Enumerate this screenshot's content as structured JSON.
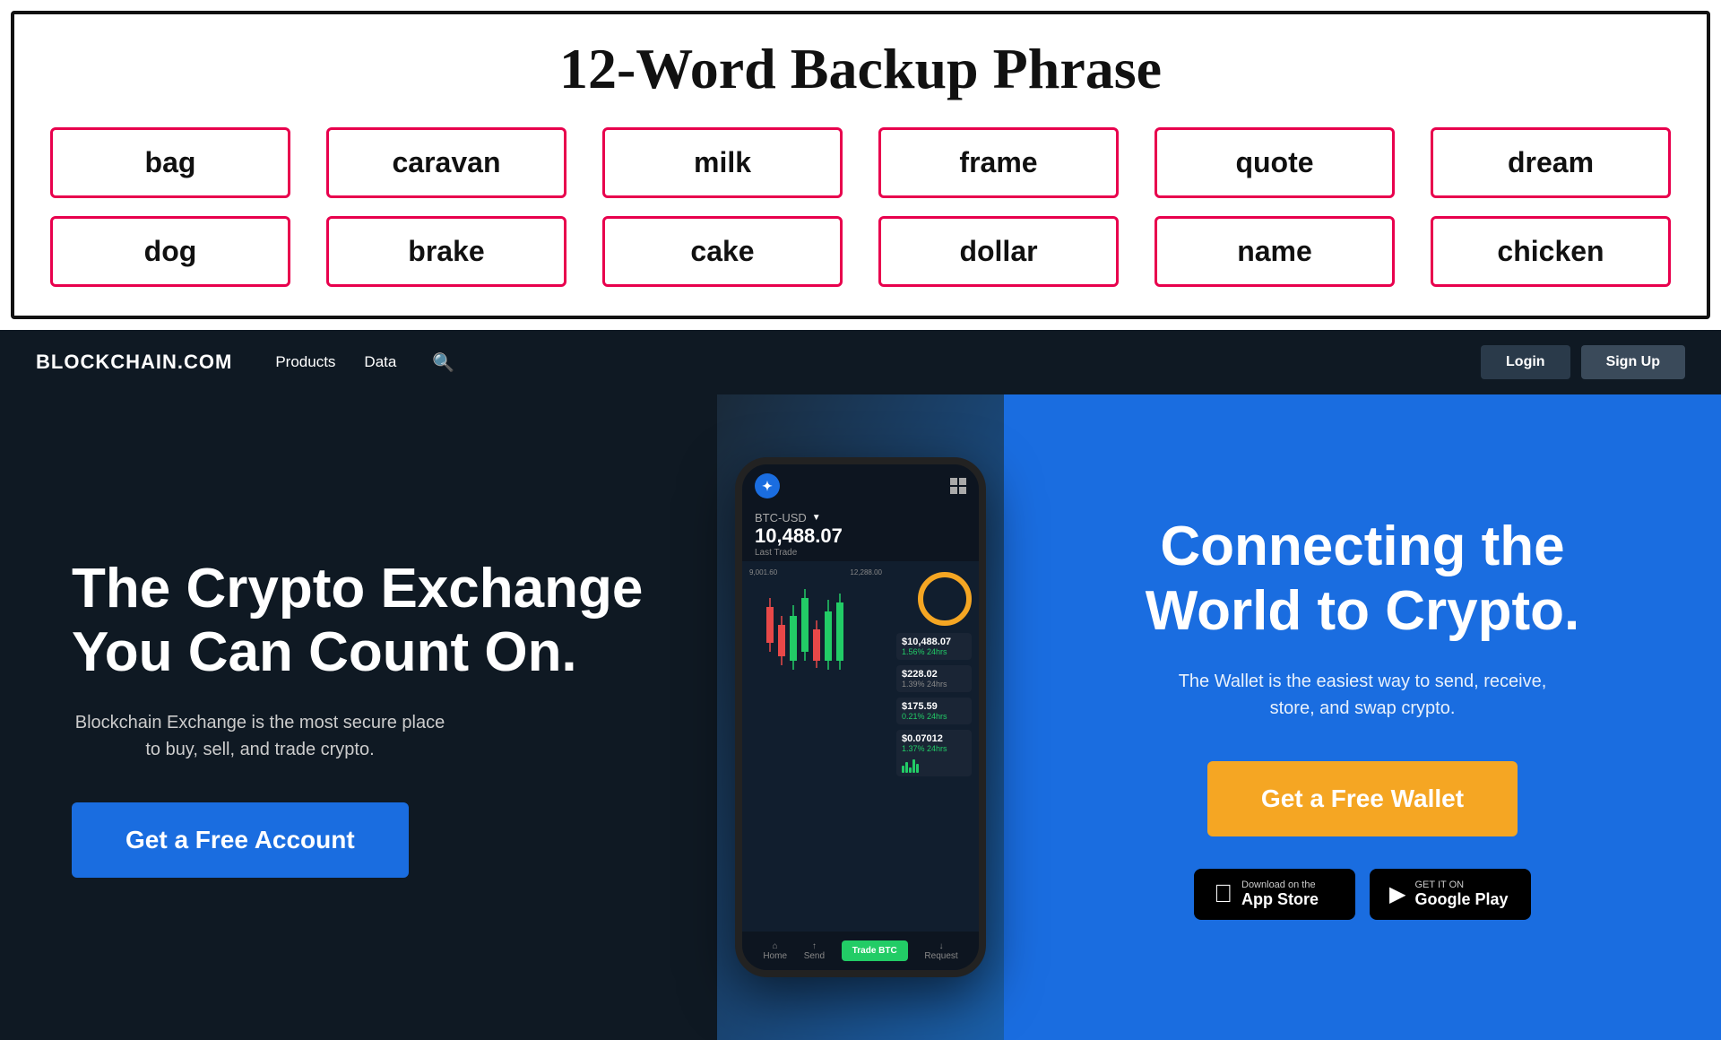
{
  "backup": {
    "title": "12-Word Backup Phrase",
    "words": [
      "bag",
      "caravan",
      "milk",
      "frame",
      "quote",
      "dream",
      "dog",
      "brake",
      "cake",
      "dollar",
      "name",
      "chicken"
    ]
  },
  "navbar": {
    "logo": "BLOCKCHAIN.COM",
    "links": [
      "Products",
      "Data"
    ],
    "search_label": "search",
    "login_label": "Login",
    "signup_label": "Sign Up"
  },
  "hero_left": {
    "heading": "The Crypto Exchange You Can Count On.",
    "subtext": "Blockchain Exchange is the most secure place to buy, sell, and trade crypto.",
    "cta": "Get a Free Account"
  },
  "hero_right": {
    "heading": "Connecting the World to Crypto.",
    "subtext": "The Wallet is the easiest way to send, receive, store, and swap crypto.",
    "cta": "Get a Free Wallet",
    "app_store": {
      "small": "Download on the",
      "large": "App Store"
    },
    "google_play": {
      "small": "GET IT ON",
      "large": "Google Play"
    }
  },
  "phone": {
    "ticker_pair": "BTC-USD",
    "price": "10,488.07",
    "last_trade": "Last Trade",
    "prices": [
      {
        "value": "$10,488.07",
        "change": "1.56% 24hrs",
        "color": "green"
      },
      {
        "value": "$228.02",
        "change": "1.39% 24hrs",
        "color": "gray"
      },
      {
        "value": "$175.59",
        "change": "0.21% 24hrs",
        "color": "green"
      },
      {
        "value": "$0.07012",
        "change": "1.37% 24hrs",
        "color": "green"
      }
    ],
    "trade_btn": "Trade BTC",
    "chart_left_label": "9,001.60",
    "chart_right_label": "12,288.00",
    "footer": [
      "Home",
      "Send",
      "Request"
    ]
  }
}
